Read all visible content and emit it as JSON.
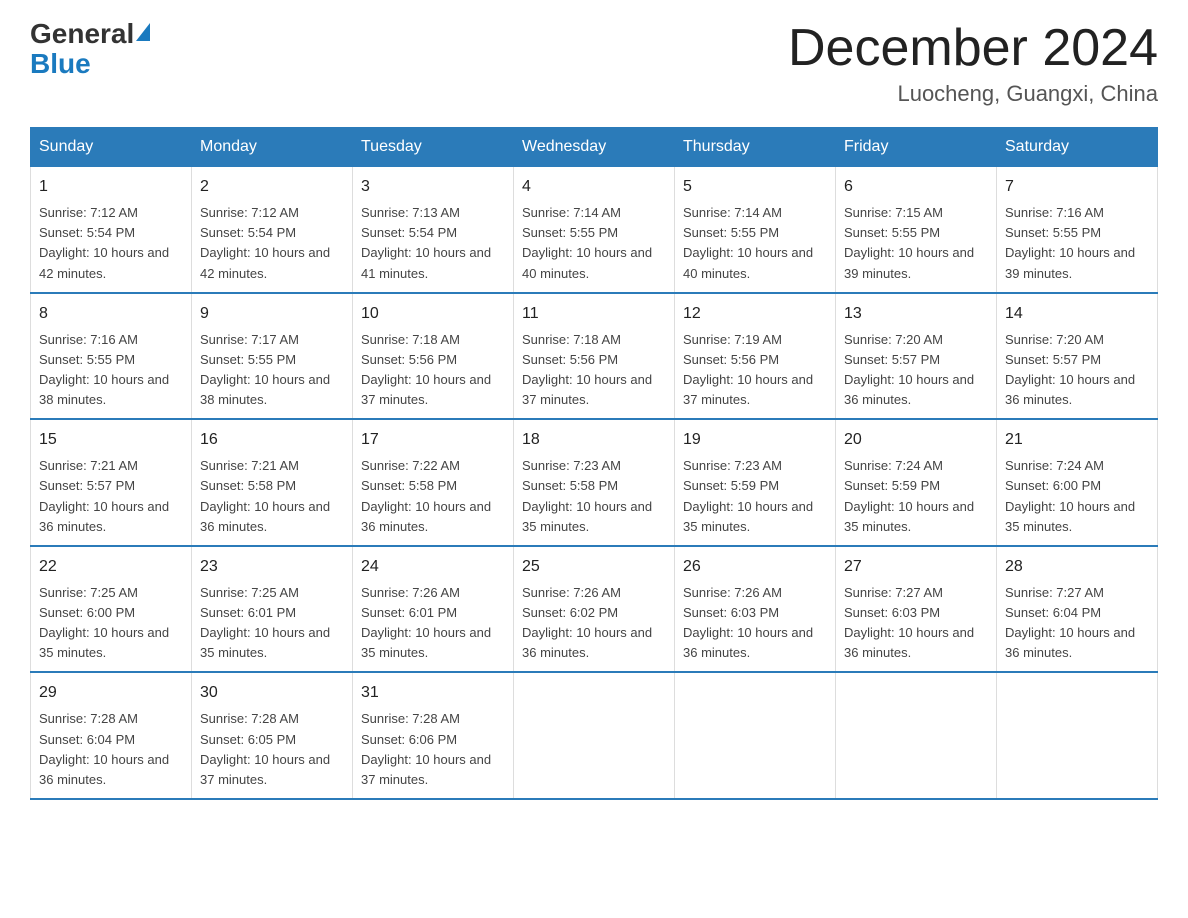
{
  "logo": {
    "general": "General",
    "blue": "Blue"
  },
  "title": "December 2024",
  "location": "Luocheng, Guangxi, China",
  "days_of_week": [
    "Sunday",
    "Monday",
    "Tuesday",
    "Wednesday",
    "Thursday",
    "Friday",
    "Saturday"
  ],
  "weeks": [
    [
      {
        "day": "1",
        "sunrise": "7:12 AM",
        "sunset": "5:54 PM",
        "daylight": "10 hours and 42 minutes."
      },
      {
        "day": "2",
        "sunrise": "7:12 AM",
        "sunset": "5:54 PM",
        "daylight": "10 hours and 42 minutes."
      },
      {
        "day": "3",
        "sunrise": "7:13 AM",
        "sunset": "5:54 PM",
        "daylight": "10 hours and 41 minutes."
      },
      {
        "day": "4",
        "sunrise": "7:14 AM",
        "sunset": "5:55 PM",
        "daylight": "10 hours and 40 minutes."
      },
      {
        "day": "5",
        "sunrise": "7:14 AM",
        "sunset": "5:55 PM",
        "daylight": "10 hours and 40 minutes."
      },
      {
        "day": "6",
        "sunrise": "7:15 AM",
        "sunset": "5:55 PM",
        "daylight": "10 hours and 39 minutes."
      },
      {
        "day": "7",
        "sunrise": "7:16 AM",
        "sunset": "5:55 PM",
        "daylight": "10 hours and 39 minutes."
      }
    ],
    [
      {
        "day": "8",
        "sunrise": "7:16 AM",
        "sunset": "5:55 PM",
        "daylight": "10 hours and 38 minutes."
      },
      {
        "day": "9",
        "sunrise": "7:17 AM",
        "sunset": "5:55 PM",
        "daylight": "10 hours and 38 minutes."
      },
      {
        "day": "10",
        "sunrise": "7:18 AM",
        "sunset": "5:56 PM",
        "daylight": "10 hours and 37 minutes."
      },
      {
        "day": "11",
        "sunrise": "7:18 AM",
        "sunset": "5:56 PM",
        "daylight": "10 hours and 37 minutes."
      },
      {
        "day": "12",
        "sunrise": "7:19 AM",
        "sunset": "5:56 PM",
        "daylight": "10 hours and 37 minutes."
      },
      {
        "day": "13",
        "sunrise": "7:20 AM",
        "sunset": "5:57 PM",
        "daylight": "10 hours and 36 minutes."
      },
      {
        "day": "14",
        "sunrise": "7:20 AM",
        "sunset": "5:57 PM",
        "daylight": "10 hours and 36 minutes."
      }
    ],
    [
      {
        "day": "15",
        "sunrise": "7:21 AM",
        "sunset": "5:57 PM",
        "daylight": "10 hours and 36 minutes."
      },
      {
        "day": "16",
        "sunrise": "7:21 AM",
        "sunset": "5:58 PM",
        "daylight": "10 hours and 36 minutes."
      },
      {
        "day": "17",
        "sunrise": "7:22 AM",
        "sunset": "5:58 PM",
        "daylight": "10 hours and 36 minutes."
      },
      {
        "day": "18",
        "sunrise": "7:23 AM",
        "sunset": "5:58 PM",
        "daylight": "10 hours and 35 minutes."
      },
      {
        "day": "19",
        "sunrise": "7:23 AM",
        "sunset": "5:59 PM",
        "daylight": "10 hours and 35 minutes."
      },
      {
        "day": "20",
        "sunrise": "7:24 AM",
        "sunset": "5:59 PM",
        "daylight": "10 hours and 35 minutes."
      },
      {
        "day": "21",
        "sunrise": "7:24 AM",
        "sunset": "6:00 PM",
        "daylight": "10 hours and 35 minutes."
      }
    ],
    [
      {
        "day": "22",
        "sunrise": "7:25 AM",
        "sunset": "6:00 PM",
        "daylight": "10 hours and 35 minutes."
      },
      {
        "day": "23",
        "sunrise": "7:25 AM",
        "sunset": "6:01 PM",
        "daylight": "10 hours and 35 minutes."
      },
      {
        "day": "24",
        "sunrise": "7:26 AM",
        "sunset": "6:01 PM",
        "daylight": "10 hours and 35 minutes."
      },
      {
        "day": "25",
        "sunrise": "7:26 AM",
        "sunset": "6:02 PM",
        "daylight": "10 hours and 36 minutes."
      },
      {
        "day": "26",
        "sunrise": "7:26 AM",
        "sunset": "6:03 PM",
        "daylight": "10 hours and 36 minutes."
      },
      {
        "day": "27",
        "sunrise": "7:27 AM",
        "sunset": "6:03 PM",
        "daylight": "10 hours and 36 minutes."
      },
      {
        "day": "28",
        "sunrise": "7:27 AM",
        "sunset": "6:04 PM",
        "daylight": "10 hours and 36 minutes."
      }
    ],
    [
      {
        "day": "29",
        "sunrise": "7:28 AM",
        "sunset": "6:04 PM",
        "daylight": "10 hours and 36 minutes."
      },
      {
        "day": "30",
        "sunrise": "7:28 AM",
        "sunset": "6:05 PM",
        "daylight": "10 hours and 37 minutes."
      },
      {
        "day": "31",
        "sunrise": "7:28 AM",
        "sunset": "6:06 PM",
        "daylight": "10 hours and 37 minutes."
      },
      null,
      null,
      null,
      null
    ]
  ]
}
